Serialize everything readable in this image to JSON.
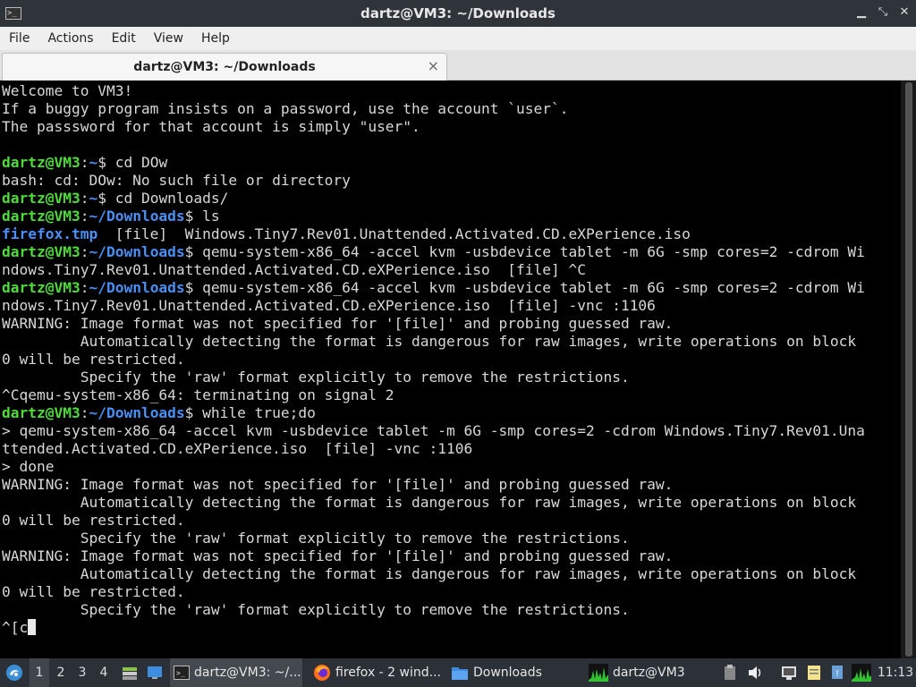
{
  "window": {
    "title": "dartz@VM3: ~/Downloads",
    "icon": "terminal-icon"
  },
  "menu": [
    "File",
    "Actions",
    "Edit",
    "View",
    "Help"
  ],
  "tab": {
    "label": "dartz@VM3: ~/Downloads",
    "close": "×"
  },
  "colors": {
    "prompt_user": "#4edb3a",
    "prompt_path": "#4a8ff5",
    "text": "#d8d8d8",
    "background": "#000000"
  },
  "terminal": {
    "lines": [
      [
        {
          "t": "Welcome to VM3!",
          "c": ""
        }
      ],
      [
        {
          "t": "If a buggy program insists on a password, use the account `user`.",
          "c": ""
        }
      ],
      [
        {
          "t": "The passsword for that account is simply \"user\".",
          "c": ""
        }
      ],
      [
        {
          "t": "",
          "c": ""
        }
      ],
      [
        {
          "t": "dartz@VM3",
          "c": "u"
        },
        {
          "t": ":",
          "c": ""
        },
        {
          "t": "~",
          "c": "p"
        },
        {
          "t": "$ cd DOw",
          "c": ""
        }
      ],
      [
        {
          "t": "bash: cd: DOw: No such file or directory",
          "c": ""
        }
      ],
      [
        {
          "t": "dartz@VM3",
          "c": "u"
        },
        {
          "t": ":",
          "c": ""
        },
        {
          "t": "~",
          "c": "p"
        },
        {
          "t": "$ cd Downloads/",
          "c": ""
        }
      ],
      [
        {
          "t": "dartz@VM3",
          "c": "u"
        },
        {
          "t": ":",
          "c": ""
        },
        {
          "t": "~/Downloads",
          "c": "p"
        },
        {
          "t": "$ ls",
          "c": ""
        }
      ],
      [
        {
          "t": "firefox.tmp",
          "c": "f"
        },
        {
          "t": "  [file]  Windows.Tiny7.Rev01.Unattended.Activated.CD.eXPerience.iso",
          "c": ""
        }
      ],
      [
        {
          "t": "dartz@VM3",
          "c": "u"
        },
        {
          "t": ":",
          "c": ""
        },
        {
          "t": "~/Downloads",
          "c": "p"
        },
        {
          "t": "$ qemu-system-x86_64 -accel kvm -usbdevice tablet -m 6G -smp cores=2 -cdrom Wi",
          "c": ""
        }
      ],
      [
        {
          "t": "ndows.Tiny7.Rev01.Unattended.Activated.CD.eXPerience.iso  [file] ^C",
          "c": ""
        }
      ],
      [
        {
          "t": "dartz@VM3",
          "c": "u"
        },
        {
          "t": ":",
          "c": ""
        },
        {
          "t": "~/Downloads",
          "c": "p"
        },
        {
          "t": "$ qemu-system-x86_64 -accel kvm -usbdevice tablet -m 6G -smp cores=2 -cdrom Wi",
          "c": ""
        }
      ],
      [
        {
          "t": "ndows.Tiny7.Rev01.Unattended.Activated.CD.eXPerience.iso  [file] -vnc :1106",
          "c": ""
        }
      ],
      [
        {
          "t": "WARNING: Image format was not specified for '[file]' and probing guessed raw.",
          "c": ""
        }
      ],
      [
        {
          "t": "         Automatically detecting the format is dangerous for raw images, write operations on block",
          "c": ""
        }
      ],
      [
        {
          "t": "0 will be restricted.",
          "c": ""
        }
      ],
      [
        {
          "t": "         Specify the 'raw' format explicitly to remove the restrictions.",
          "c": ""
        }
      ],
      [
        {
          "t": "^Cqemu-system-x86_64: terminating on signal 2",
          "c": ""
        }
      ],
      [
        {
          "t": "dartz@VM3",
          "c": "u"
        },
        {
          "t": ":",
          "c": ""
        },
        {
          "t": "~/Downloads",
          "c": "p"
        },
        {
          "t": "$ while true;do",
          "c": ""
        }
      ],
      [
        {
          "t": "> qemu-system-x86_64 -accel kvm -usbdevice tablet -m 6G -smp cores=2 -cdrom Windows.Tiny7.Rev01.Una",
          "c": ""
        }
      ],
      [
        {
          "t": "ttended.Activated.CD.eXPerience.iso  [file] -vnc :1106",
          "c": ""
        }
      ],
      [
        {
          "t": "> done",
          "c": ""
        }
      ],
      [
        {
          "t": "WARNING: Image format was not specified for '[file]' and probing guessed raw.",
          "c": ""
        }
      ],
      [
        {
          "t": "         Automatically detecting the format is dangerous for raw images, write operations on block",
          "c": ""
        }
      ],
      [
        {
          "t": "0 will be restricted.",
          "c": ""
        }
      ],
      [
        {
          "t": "         Specify the 'raw' format explicitly to remove the restrictions.",
          "c": ""
        }
      ],
      [
        {
          "t": "WARNING: Image format was not specified for '[file]' and probing guessed raw.",
          "c": ""
        }
      ],
      [
        {
          "t": "         Automatically detecting the format is dangerous for raw images, write operations on block",
          "c": ""
        }
      ],
      [
        {
          "t": "0 will be restricted.",
          "c": ""
        }
      ],
      [
        {
          "t": "         Specify the 'raw' format explicitly to remove the restrictions.",
          "c": ""
        }
      ],
      [
        {
          "t": "^[c",
          "c": ""
        }
      ]
    ]
  },
  "taskbar": {
    "workspaces": [
      "1",
      "2",
      "3",
      "4"
    ],
    "active_workspace": "1",
    "tasks": [
      {
        "label": "dartz@VM3: ~/...",
        "icon": "terminal-icon",
        "active": true
      },
      {
        "label": "firefox - 2 wind...",
        "icon": "firefox-icon",
        "active": false
      },
      {
        "label": "Downloads",
        "icon": "folder-icon",
        "active": false
      },
      {
        "label": "dartz@VM3",
        "icon": "cpu-graph-icon",
        "active": false
      }
    ],
    "clock": "11:13"
  }
}
